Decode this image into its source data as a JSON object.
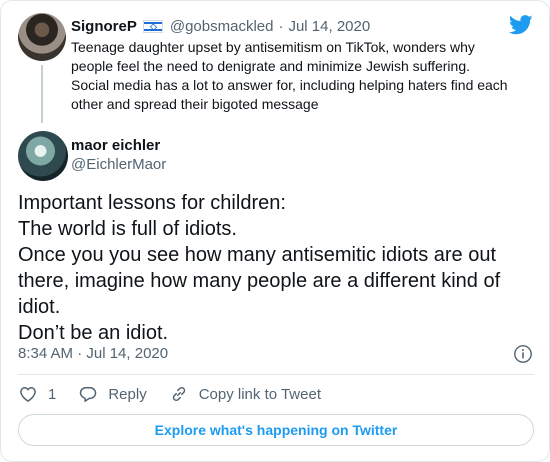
{
  "parent_tweet": {
    "display_name": "SignoreP",
    "flag_icon": "israel-flag-icon",
    "handle": "@gobsmackled",
    "separator": "·",
    "date": "Jul 14, 2020",
    "text": "Teenage daughter upset by antisemitism on TikTok, wonders why people feel the need to denigrate and minimize Jewish suffering. Social media has a lot to answer for, including helping haters find each other and spread their bigoted message"
  },
  "main_tweet": {
    "display_name": "maor eichler",
    "handle": "@EichlerMaor",
    "lines": [
      "Important lessons for children:",
      "The world is full of idiots.",
      "Once you you see how many antisemitic idiots are out there, imagine how many people are a different kind of idiot.",
      "Don’t be an idiot."
    ],
    "timestamp": "8:34 AM · Jul 14, 2020"
  },
  "actions": {
    "like_count": "1",
    "reply_label": "Reply",
    "copy_link_label": "Copy link to Tweet"
  },
  "explore_label": "Explore what's happening on Twitter",
  "colors": {
    "accent": "#1d9bf0",
    "secondary_text": "#536471",
    "border": "#e1e8ed"
  }
}
